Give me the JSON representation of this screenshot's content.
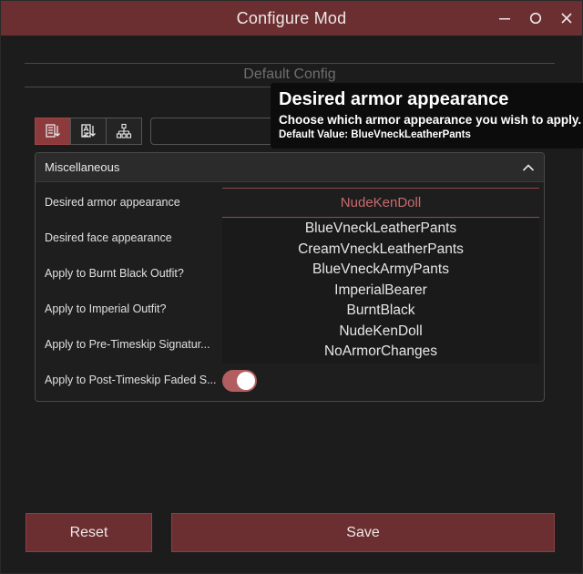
{
  "window": {
    "title": "Configure Mod",
    "controls": {
      "minimize": "—",
      "maximize": "O",
      "close": "X"
    }
  },
  "config": {
    "title": "Default Config"
  },
  "toolbar": {
    "buttons": [
      {
        "icon": "sort-list-icon",
        "active": true
      },
      {
        "icon": "sort-alpha-icon",
        "active": false
      },
      {
        "icon": "hierarchy-icon",
        "active": false
      }
    ],
    "search": {
      "value": "",
      "placeholder": ""
    }
  },
  "panel": {
    "title": "Miscellaneous",
    "rows": [
      {
        "label": "Desired armor appearance"
      },
      {
        "label": "Desired face appearance"
      },
      {
        "label": "Apply to Burnt Black Outfit?"
      },
      {
        "label": "Apply to Imperial Outfit?"
      },
      {
        "label": "Apply to Pre-Timeskip Signatur..."
      },
      {
        "label": "Apply to Post-Timeskip Faded S..."
      }
    ],
    "dropdown": {
      "selected": "NudeKenDoll",
      "options": [
        "BlueVneckLeatherPants",
        "CreamVneckLeatherPants",
        "BlueVneckArmyPants",
        "ImperialBearer",
        "BurntBlack",
        "NudeKenDoll",
        "NoArmorChanges"
      ]
    },
    "toggle": {
      "on": true
    }
  },
  "tooltip": {
    "title": "Desired armor appearance",
    "description": "Choose which armor appearance you wish to apply.",
    "default_value": "Default Value:  BlueVneckLeatherPants"
  },
  "buttons": {
    "reset": "Reset",
    "save": "Save"
  },
  "colors": {
    "accent": "#6b2f31",
    "accent_active": "#8c3a3c",
    "selected_text": "#c96a6c",
    "toggle_on": "#b25d5f",
    "background": "#1c1c1d"
  }
}
